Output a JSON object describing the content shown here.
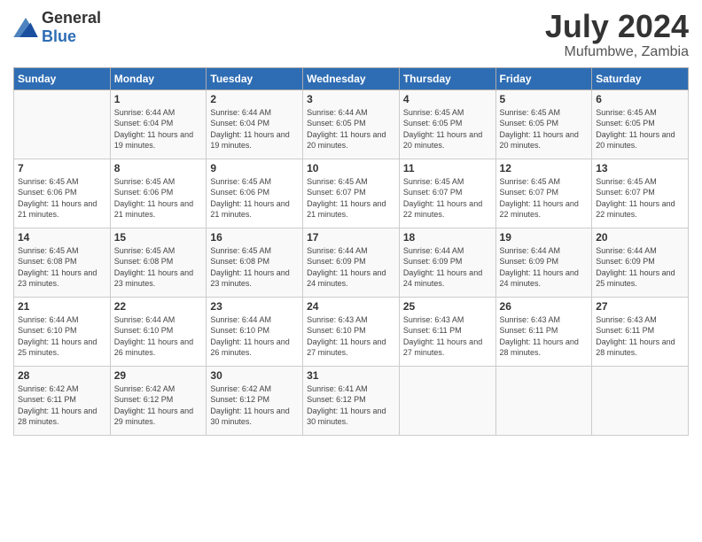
{
  "logo": {
    "general": "General",
    "blue": "Blue"
  },
  "title": "July 2024",
  "location": "Mufumbwe, Zambia",
  "headers": [
    "Sunday",
    "Monday",
    "Tuesday",
    "Wednesday",
    "Thursday",
    "Friday",
    "Saturday"
  ],
  "weeks": [
    [
      {
        "day": "",
        "sunrise": "",
        "sunset": "",
        "daylight": ""
      },
      {
        "day": "1",
        "sunrise": "Sunrise: 6:44 AM",
        "sunset": "Sunset: 6:04 PM",
        "daylight": "Daylight: 11 hours and 19 minutes."
      },
      {
        "day": "2",
        "sunrise": "Sunrise: 6:44 AM",
        "sunset": "Sunset: 6:04 PM",
        "daylight": "Daylight: 11 hours and 19 minutes."
      },
      {
        "day": "3",
        "sunrise": "Sunrise: 6:44 AM",
        "sunset": "Sunset: 6:05 PM",
        "daylight": "Daylight: 11 hours and 20 minutes."
      },
      {
        "day": "4",
        "sunrise": "Sunrise: 6:45 AM",
        "sunset": "Sunset: 6:05 PM",
        "daylight": "Daylight: 11 hours and 20 minutes."
      },
      {
        "day": "5",
        "sunrise": "Sunrise: 6:45 AM",
        "sunset": "Sunset: 6:05 PM",
        "daylight": "Daylight: 11 hours and 20 minutes."
      },
      {
        "day": "6",
        "sunrise": "Sunrise: 6:45 AM",
        "sunset": "Sunset: 6:05 PM",
        "daylight": "Daylight: 11 hours and 20 minutes."
      }
    ],
    [
      {
        "day": "7",
        "sunrise": "Sunrise: 6:45 AM",
        "sunset": "Sunset: 6:06 PM",
        "daylight": "Daylight: 11 hours and 21 minutes."
      },
      {
        "day": "8",
        "sunrise": "Sunrise: 6:45 AM",
        "sunset": "Sunset: 6:06 PM",
        "daylight": "Daylight: 11 hours and 21 minutes."
      },
      {
        "day": "9",
        "sunrise": "Sunrise: 6:45 AM",
        "sunset": "Sunset: 6:06 PM",
        "daylight": "Daylight: 11 hours and 21 minutes."
      },
      {
        "day": "10",
        "sunrise": "Sunrise: 6:45 AM",
        "sunset": "Sunset: 6:07 PM",
        "daylight": "Daylight: 11 hours and 21 minutes."
      },
      {
        "day": "11",
        "sunrise": "Sunrise: 6:45 AM",
        "sunset": "Sunset: 6:07 PM",
        "daylight": "Daylight: 11 hours and 22 minutes."
      },
      {
        "day": "12",
        "sunrise": "Sunrise: 6:45 AM",
        "sunset": "Sunset: 6:07 PM",
        "daylight": "Daylight: 11 hours and 22 minutes."
      },
      {
        "day": "13",
        "sunrise": "Sunrise: 6:45 AM",
        "sunset": "Sunset: 6:07 PM",
        "daylight": "Daylight: 11 hours and 22 minutes."
      }
    ],
    [
      {
        "day": "14",
        "sunrise": "Sunrise: 6:45 AM",
        "sunset": "Sunset: 6:08 PM",
        "daylight": "Daylight: 11 hours and 23 minutes."
      },
      {
        "day": "15",
        "sunrise": "Sunrise: 6:45 AM",
        "sunset": "Sunset: 6:08 PM",
        "daylight": "Daylight: 11 hours and 23 minutes."
      },
      {
        "day": "16",
        "sunrise": "Sunrise: 6:45 AM",
        "sunset": "Sunset: 6:08 PM",
        "daylight": "Daylight: 11 hours and 23 minutes."
      },
      {
        "day": "17",
        "sunrise": "Sunrise: 6:44 AM",
        "sunset": "Sunset: 6:09 PM",
        "daylight": "Daylight: 11 hours and 24 minutes."
      },
      {
        "day": "18",
        "sunrise": "Sunrise: 6:44 AM",
        "sunset": "Sunset: 6:09 PM",
        "daylight": "Daylight: 11 hours and 24 minutes."
      },
      {
        "day": "19",
        "sunrise": "Sunrise: 6:44 AM",
        "sunset": "Sunset: 6:09 PM",
        "daylight": "Daylight: 11 hours and 24 minutes."
      },
      {
        "day": "20",
        "sunrise": "Sunrise: 6:44 AM",
        "sunset": "Sunset: 6:09 PM",
        "daylight": "Daylight: 11 hours and 25 minutes."
      }
    ],
    [
      {
        "day": "21",
        "sunrise": "Sunrise: 6:44 AM",
        "sunset": "Sunset: 6:10 PM",
        "daylight": "Daylight: 11 hours and 25 minutes."
      },
      {
        "day": "22",
        "sunrise": "Sunrise: 6:44 AM",
        "sunset": "Sunset: 6:10 PM",
        "daylight": "Daylight: 11 hours and 26 minutes."
      },
      {
        "day": "23",
        "sunrise": "Sunrise: 6:44 AM",
        "sunset": "Sunset: 6:10 PM",
        "daylight": "Daylight: 11 hours and 26 minutes."
      },
      {
        "day": "24",
        "sunrise": "Sunrise: 6:43 AM",
        "sunset": "Sunset: 6:10 PM",
        "daylight": "Daylight: 11 hours and 27 minutes."
      },
      {
        "day": "25",
        "sunrise": "Sunrise: 6:43 AM",
        "sunset": "Sunset: 6:11 PM",
        "daylight": "Daylight: 11 hours and 27 minutes."
      },
      {
        "day": "26",
        "sunrise": "Sunrise: 6:43 AM",
        "sunset": "Sunset: 6:11 PM",
        "daylight": "Daylight: 11 hours and 28 minutes."
      },
      {
        "day": "27",
        "sunrise": "Sunrise: 6:43 AM",
        "sunset": "Sunset: 6:11 PM",
        "daylight": "Daylight: 11 hours and 28 minutes."
      }
    ],
    [
      {
        "day": "28",
        "sunrise": "Sunrise: 6:42 AM",
        "sunset": "Sunset: 6:11 PM",
        "daylight": "Daylight: 11 hours and 28 minutes."
      },
      {
        "day": "29",
        "sunrise": "Sunrise: 6:42 AM",
        "sunset": "Sunset: 6:12 PM",
        "daylight": "Daylight: 11 hours and 29 minutes."
      },
      {
        "day": "30",
        "sunrise": "Sunrise: 6:42 AM",
        "sunset": "Sunset: 6:12 PM",
        "daylight": "Daylight: 11 hours and 30 minutes."
      },
      {
        "day": "31",
        "sunrise": "Sunrise: 6:41 AM",
        "sunset": "Sunset: 6:12 PM",
        "daylight": "Daylight: 11 hours and 30 minutes."
      },
      {
        "day": "",
        "sunrise": "",
        "sunset": "",
        "daylight": ""
      },
      {
        "day": "",
        "sunrise": "",
        "sunset": "",
        "daylight": ""
      },
      {
        "day": "",
        "sunrise": "",
        "sunset": "",
        "daylight": ""
      }
    ]
  ]
}
